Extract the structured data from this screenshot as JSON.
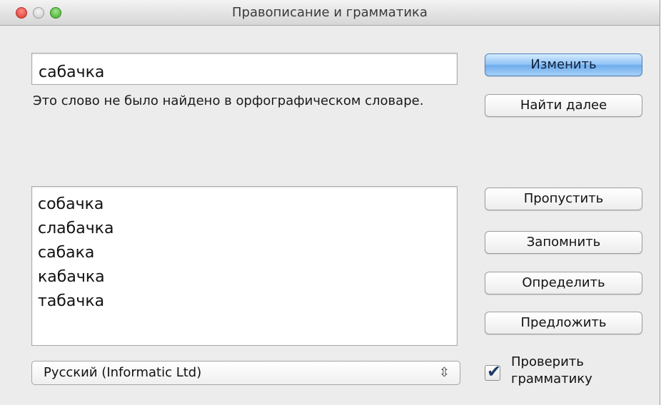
{
  "window": {
    "title": "Правописание и грамматика"
  },
  "word_field": {
    "value": "сабачка"
  },
  "message": "Это слово не было найдено в орфографическом словаре.",
  "suggestions": [
    "собачка",
    "слабачка",
    "сабака",
    "кабачка",
    "табачка"
  ],
  "language": {
    "selected": "Русский (Informatic Ltd)",
    "arrows_icon": "up-down-arrows-icon"
  },
  "buttons": {
    "change": "Изменить",
    "find_next": "Найти далее",
    "ignore": "Пропустить",
    "learn": "Запомнить",
    "define": "Определить",
    "guess": "Предложить"
  },
  "check_grammar": {
    "label": "Проверить грамматику",
    "checked": true
  },
  "colors": {
    "default_button": "#8fc2f4",
    "close": "#d8352c",
    "maximize": "#3ea826"
  }
}
